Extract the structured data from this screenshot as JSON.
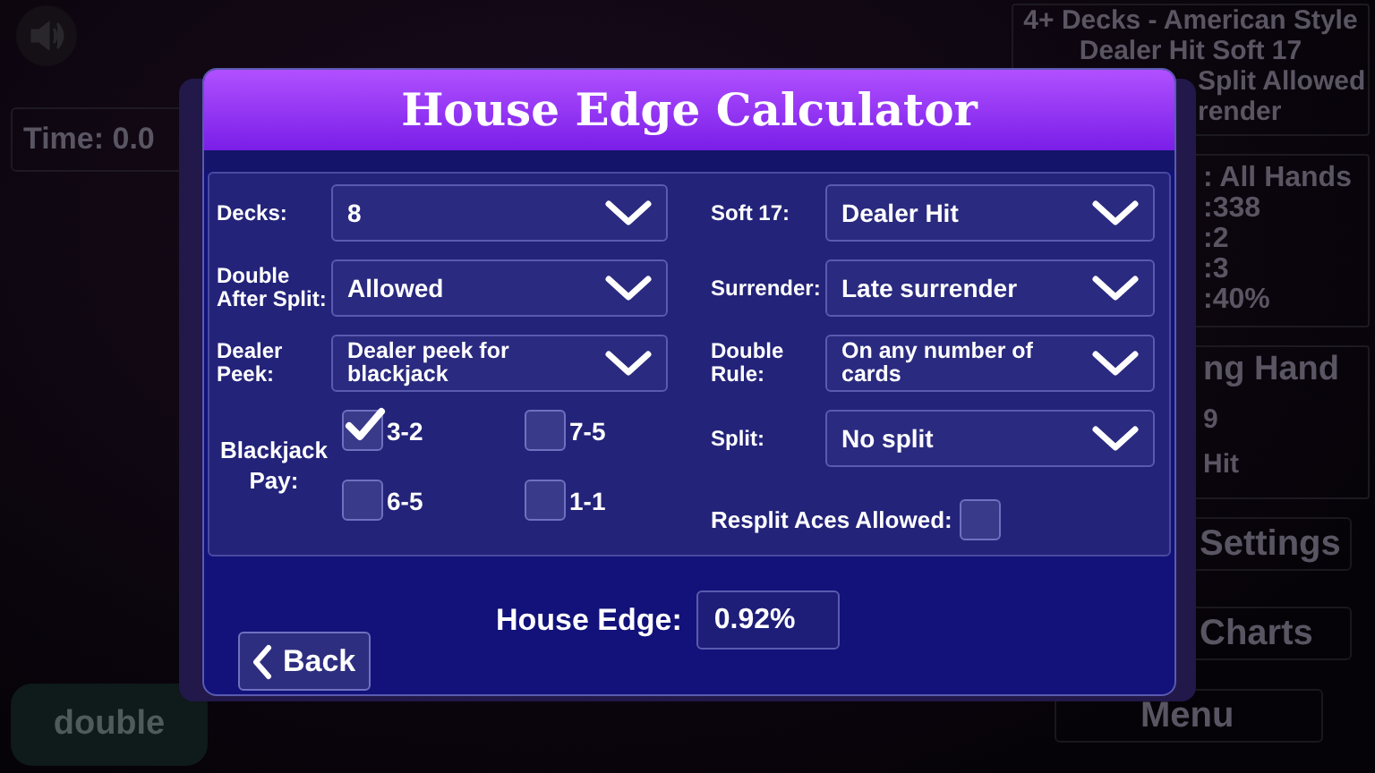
{
  "background": {
    "time": "Time: 0.0",
    "rules_full": [
      "4+ Decks - American Style",
      "Dealer Hit Soft 17"
    ],
    "rules_cut": [
      "Split Allowed",
      "render"
    ],
    "stats": [
      ": All Hands",
      ":338",
      ":2",
      ":3",
      ":40%"
    ],
    "hand_title": "ng Hand",
    "hand_lines": [
      "9",
      "Hit"
    ],
    "buttons": [
      "Settings",
      "Charts"
    ],
    "menu_button": "Menu",
    "double_button": "double"
  },
  "dialog": {
    "title": "House Edge Calculator",
    "left_fields": [
      {
        "label": "Decks:",
        "value": "8"
      },
      {
        "label": "Double After Split:",
        "value": "Allowed"
      },
      {
        "label": "Dealer Peek:",
        "value": "Dealer peek for blackjack"
      }
    ],
    "right_fields": [
      {
        "label": "Soft 17:",
        "value": "Dealer Hit"
      },
      {
        "label": "Surrender:",
        "value": "Late surrender"
      },
      {
        "label": "Double Rule:",
        "value": "On any number of cards"
      },
      {
        "label": "Split:",
        "value": "No split"
      }
    ],
    "blackjack_pay": {
      "label": "Blackjack Pay:",
      "options": [
        {
          "label": "3-2",
          "checked": true
        },
        {
          "label": "7-5",
          "checked": false
        },
        {
          "label": "6-5",
          "checked": false
        },
        {
          "label": "1-1",
          "checked": false
        }
      ]
    },
    "resplit": {
      "label": "Resplit Aces Allowed:",
      "checked": false
    },
    "house_edge": {
      "label": "House Edge:",
      "value": "0.92%"
    },
    "back_button": "Back"
  }
}
